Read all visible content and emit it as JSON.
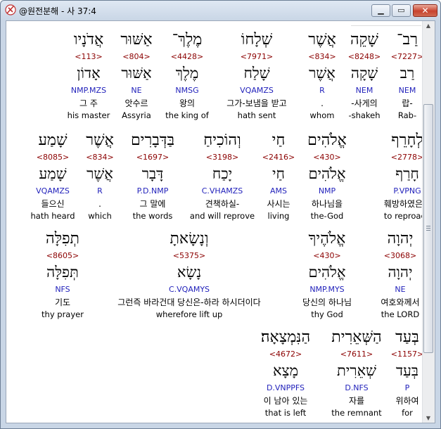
{
  "window": {
    "title": "@원전분해 - 사 37:4"
  },
  "rows": [
    [
      {
        "heb": "רַב־",
        "num": "<7227>",
        "lemma": "רַב",
        "parse": "NEM",
        "kor": "랍-",
        "eng": "Rab-"
      },
      {
        "heb": "שָׁקֵה",
        "num": "<8248>",
        "lemma": "שָׁקָה",
        "parse": "NEM",
        "kor": "-사게의",
        "eng": "-shakeh"
      },
      {
        "heb": "אֲשֶׁר",
        "num": "<834>",
        "lemma": "אֲשֶׁר",
        "parse": "R",
        "kor": ".",
        "eng": "whom"
      },
      {
        "heb": "שְׁלָחוֹ",
        "num": "<7971>",
        "lemma": "שָׁלַח",
        "parse": "VQAMZS",
        "kor": "그가-보냄을 받고",
        "eng": "hath sent"
      },
      {
        "heb": "מֶלֶךְ־",
        "num": "<4428>",
        "lemma": "מֶלֶךְ",
        "parse": "NMSG",
        "kor": "왕의",
        "eng": "the king of"
      },
      {
        "heb": "אַשּׁוּר",
        "num": "<804>",
        "lemma": "אַשּׁוּר",
        "parse": "NE",
        "kor": "앗수르",
        "eng": "Assyria"
      },
      {
        "heb": "אֲדֹנָיו",
        "num": "<113>",
        "lemma": "אָדוֹן",
        "parse": "NMP.MZS",
        "kor": "그 주",
        "eng": "his master"
      }
    ],
    [
      {
        "heb": "לְחָרֵף",
        "num": "<2778>",
        "lemma": "חָרַף",
        "parse": "P.VPNG",
        "kor": "훼방하였은즉",
        "eng": "to reproach"
      },
      {
        "heb": "אֱלֹהִים",
        "num": "<430>",
        "lemma": "אֱלֹהִים",
        "parse": "NMP",
        "kor": "하나님을",
        "eng": "the-God"
      },
      {
        "heb": "חַי",
        "num": "<2416>",
        "lemma": "חַי",
        "parse": "AMS",
        "kor": "사시는",
        "eng": "living"
      },
      {
        "heb": "וְהוֹכִיחַ",
        "num": "<3198>",
        "lemma": "יָכַח",
        "parse": "C.VHAMZS",
        "kor": "견책하실-",
        "eng": "and will reprove"
      },
      {
        "heb": "בַּדְּבָרִים",
        "num": "<1697>",
        "lemma": "דָּבָר",
        "parse": "P.D.NMP",
        "kor": "그 말에",
        "eng": "the words"
      },
      {
        "heb": "אֲשֶׁר",
        "num": "<834>",
        "lemma": "אֲשֶׁר",
        "parse": "R",
        "kor": ".",
        "eng": "which"
      },
      {
        "heb": "שָׁמַע",
        "num": "<8085>",
        "lemma": "שָׁמַע",
        "parse": "VQAMZS",
        "kor": "들으신",
        "eng": "hath heard"
      }
    ],
    [
      {
        "heb": "יְהוָה",
        "num": "<3068>",
        "lemma": "יְהוָה",
        "parse": "NE",
        "kor": "여호와께서",
        "eng": "the LORD"
      },
      {
        "heb": "אֱלֹהֶיךָ",
        "num": "<430>",
        "lemma": "אֱלֹהִים",
        "parse": "NMP.MYS",
        "kor": "당신의 하나님",
        "eng": "thy God"
      },
      {
        "heb": "וְנָשָׂאתָ",
        "num": "<5375>",
        "lemma": "נָשָׂא",
        "parse": "C.VQAMYS",
        "kor": "그런즉 바라건대 당신은-하라 하시더이다",
        "eng": "wherefore lift up"
      },
      {
        "heb": "תְפִלָּה",
        "num": "<8605>",
        "lemma": "תְּפִלָּה",
        "parse": "NFS",
        "kor": "기도",
        "eng": "thy prayer"
      }
    ],
    [
      {
        "heb": "בְּעַד",
        "num": "<1157>",
        "lemma": "בְּעַד",
        "parse": "P",
        "kor": "위하여",
        "eng": "for"
      },
      {
        "heb": "הַשְּׁאֵרִית",
        "num": "<7611>",
        "lemma": "שְׁאֵרִית",
        "parse": "D.NFS",
        "kor": "자를",
        "eng": "the remnant"
      },
      {
        "heb": "הַנִּמְצָאָה׃",
        "num": "<4672>",
        "lemma": "מָצָא",
        "parse": "D.VNPPFS",
        "kor": "이 남아 있는",
        "eng": "that is left"
      }
    ]
  ]
}
